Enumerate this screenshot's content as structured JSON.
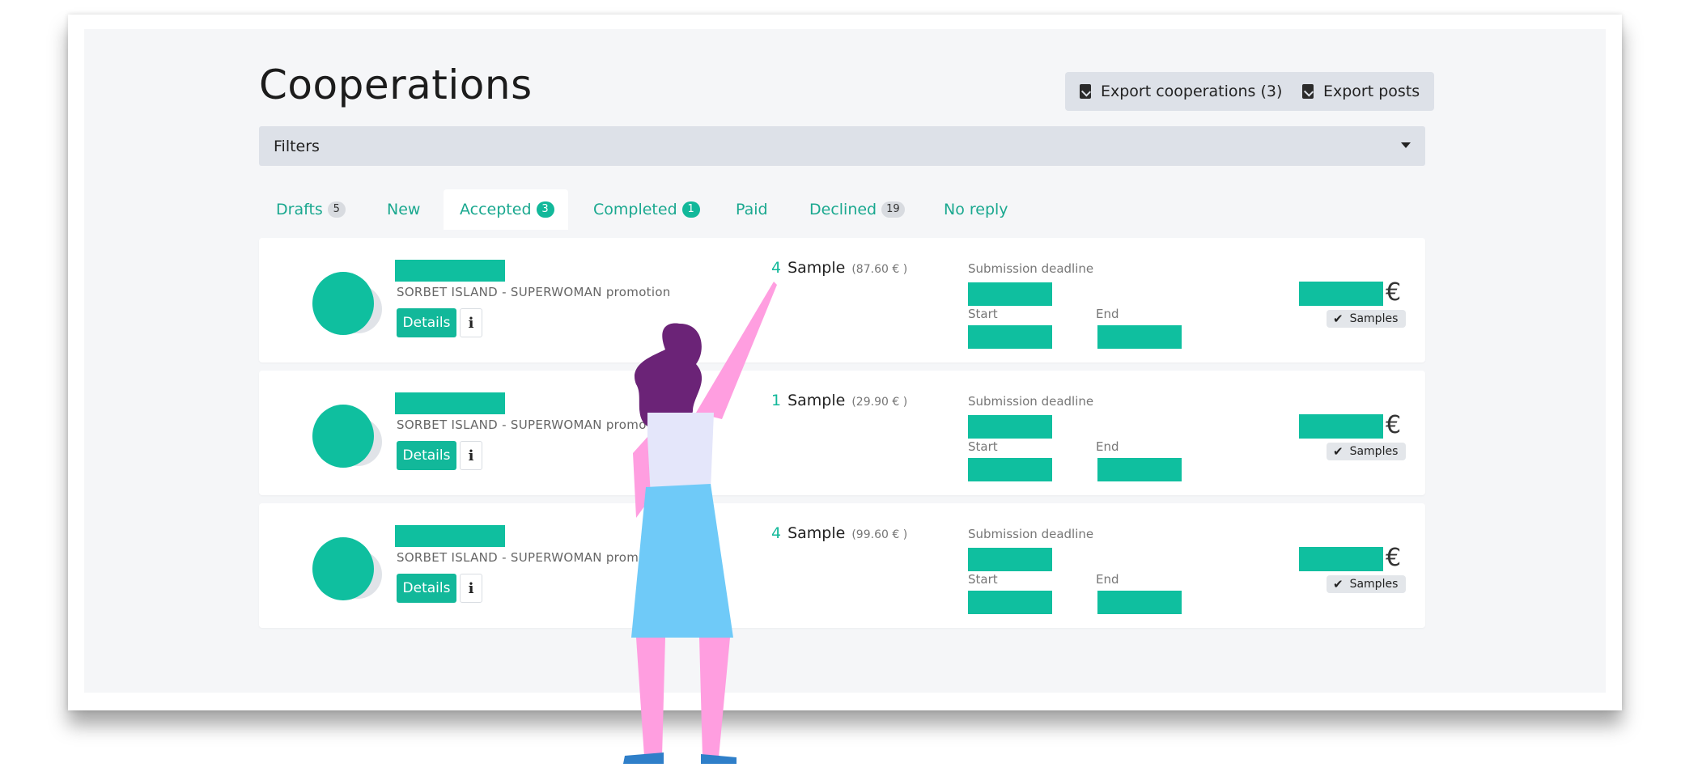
{
  "page": {
    "title": "Cooperations",
    "export_cooperations": "Export cooperations (3)",
    "export_posts": "Export posts",
    "filters_label": "Filters"
  },
  "tabs": [
    {
      "label": "Drafts",
      "count": "5",
      "badge_style": "grey"
    },
    {
      "label": "New",
      "count": "",
      "badge_style": ""
    },
    {
      "label": "Accepted",
      "count": "3",
      "badge_style": "teal",
      "active": true
    },
    {
      "label": "Completed",
      "count": "1",
      "badge_style": "teal"
    },
    {
      "label": "Paid",
      "count": "",
      "badge_style": ""
    },
    {
      "label": "Declined",
      "count": "19",
      "badge_style": "grey"
    },
    {
      "label": "No reply",
      "count": "",
      "badge_style": ""
    }
  ],
  "cards": [
    {
      "campaign": "SORBET ISLAND - SUPERWOMAN promotion",
      "sample_count": "4",
      "sample_word": "Sample",
      "sample_price": "(87.60 € )"
    },
    {
      "campaign": "SORBET ISLAND - SUPERWOMAN promotion",
      "sample_count": "1",
      "sample_word": "Sample",
      "sample_price": "(29.90 € )"
    },
    {
      "campaign": "SORBET ISLAND - SUPERWOMAN promotion",
      "sample_count": "4",
      "sample_word": "Sample",
      "sample_price": "(99.60 € )"
    }
  ],
  "card_labels": {
    "details": "Details",
    "info": "i",
    "submission_deadline": "Submission deadline",
    "start": "Start",
    "end": "End",
    "currency": "€",
    "samples_tag": "Samples",
    "check": "✔"
  },
  "colors": {
    "accent": "#12b89a",
    "redaction": "#0fbf9f",
    "panel": "#dde1e8",
    "background": "#f5f6f8"
  },
  "icons": {
    "export": "file-export-icon",
    "caret": "caret-down-icon",
    "check": "check-icon"
  }
}
